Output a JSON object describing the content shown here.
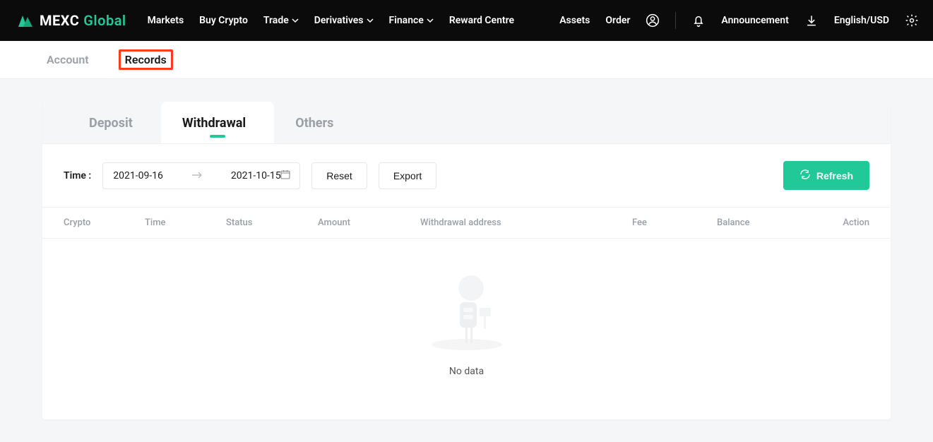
{
  "brand": {
    "name": "MEXC",
    "suffix": "Global"
  },
  "nav": {
    "left": [
      {
        "label": "Markets",
        "caret": false
      },
      {
        "label": "Buy Crypto",
        "caret": false
      },
      {
        "label": "Trade",
        "caret": true
      },
      {
        "label": "Derivatives",
        "caret": true
      },
      {
        "label": "Finance",
        "caret": true
      },
      {
        "label": "Reward Centre",
        "caret": false
      }
    ],
    "right_links": {
      "assets": "Assets",
      "order": "Order",
      "announcement": "Announcement",
      "locale": "English/USD"
    }
  },
  "section_tabs": {
    "account": "Account",
    "records": "Records",
    "active": "records"
  },
  "record_tabs": {
    "items": [
      "Deposit",
      "Withdrawal",
      "Others"
    ],
    "active_index": 1
  },
  "filters": {
    "time_label": "Time :",
    "date_from": "2021-09-16",
    "date_to": "2021-10-15",
    "reset": "Reset",
    "export": "Export",
    "refresh": "Refresh"
  },
  "table": {
    "columns": [
      "Crypto",
      "Time",
      "Status",
      "Amount",
      "Withdrawal address",
      "Fee",
      "Balance",
      "Action"
    ]
  },
  "empty_text": "No data"
}
